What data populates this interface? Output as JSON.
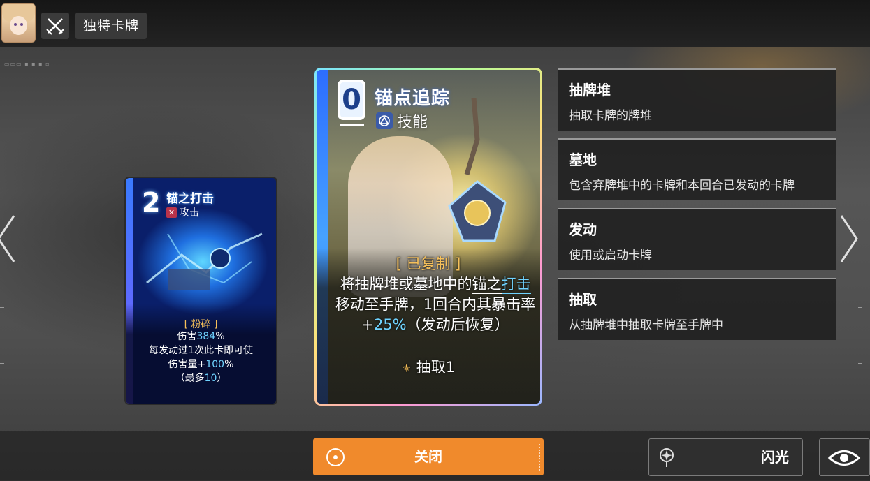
{
  "header": {
    "title": "独特卡牌",
    "avatar_icon": "character-avatar",
    "mode_icon": "crossed-swords-icon"
  },
  "cards": {
    "small": {
      "cost": "2",
      "name": "锚之打击",
      "type": "攻击",
      "type_icon": "attack-icon",
      "keyword": "[ 粉碎 ]",
      "desc_line1_a": "伤害",
      "desc_line1_hl": "384",
      "desc_line1_b": "%",
      "desc_line2": "每发动过1次此卡即可使",
      "desc_line3_a": "伤害量+",
      "desc_line3_hl": "100",
      "desc_line3_b": "%",
      "desc_line4_a": "（最多",
      "desc_line4_hl": "10",
      "desc_line4_b": "）"
    },
    "big": {
      "cost": "0",
      "name": "锚点追踪",
      "type": "技能",
      "type_icon": "skill-icon",
      "keyword": "[ 已复制 ]",
      "desc_a": "将抽牌堆或墓地中的",
      "desc_link": "锚之",
      "desc_link2": "打击",
      "desc_b": "移动至手牌，1回合内其暴击率+",
      "desc_hl": "25%",
      "desc_c": "（发动后恢复）",
      "draw": "抽取1",
      "draw_icon": "draw-icon"
    }
  },
  "info_panels": [
    {
      "title": "抽牌堆",
      "desc": "抽取卡牌的牌堆"
    },
    {
      "title": "墓地",
      "desc": "包含弃牌堆中的卡牌和本回合已发动的卡牌"
    },
    {
      "title": "发动",
      "desc": "使用或启动卡牌"
    },
    {
      "title": "抽取",
      "desc": "从抽牌堆中抽取卡牌至手牌中"
    }
  ],
  "bottom": {
    "close_label": "关闭",
    "flash_label": "闪光"
  },
  "colors": {
    "accent_orange": "#f08a2c",
    "highlight_blue": "#6fd3ff",
    "keyword_gold": "#f6c05a"
  }
}
